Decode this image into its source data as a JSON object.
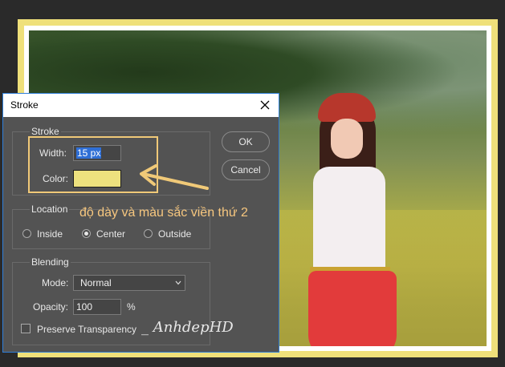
{
  "dialog": {
    "title": "Stroke",
    "ok_label": "OK",
    "cancel_label": "Cancel",
    "stroke_group": {
      "legend": "Stroke",
      "width_label": "Width:",
      "width_value": "15 px",
      "color_label": "Color:",
      "color_hex": "#ede17e"
    },
    "location_group": {
      "legend": "Location",
      "options": [
        "Inside",
        "Center",
        "Outside"
      ],
      "selected": "Center"
    },
    "blending_group": {
      "legend": "Blending",
      "mode_label": "Mode:",
      "mode_value": "Normal",
      "opacity_label": "Opacity:",
      "opacity_value": "100",
      "opacity_unit": "%",
      "preserve_label": "Preserve Transparency",
      "preserve_checked": false
    }
  },
  "annotation": {
    "text": "độ dày và màu sắc viền thứ 2",
    "color": "#f7c77f"
  },
  "watermark": "_ AnhdepHD",
  "frame_colors": {
    "outer": "#efe07a",
    "inner": "#ffffff"
  },
  "icons": {
    "close": "close-icon",
    "dropdown": "chevron-down-icon",
    "arrow": "arrow-left-icon"
  }
}
